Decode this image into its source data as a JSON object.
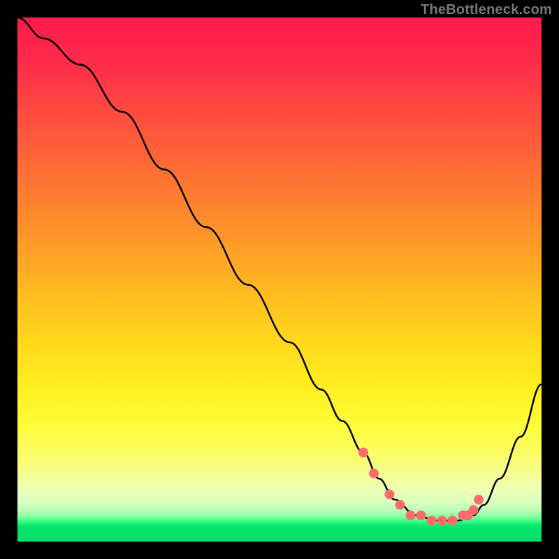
{
  "watermark": "TheBottleneck.com",
  "chart_data": {
    "type": "line",
    "title": "",
    "xlabel": "",
    "ylabel": "",
    "xlim": [
      0,
      100
    ],
    "ylim": [
      0,
      100
    ],
    "grid": false,
    "series": [
      {
        "name": "curve",
        "color": "#000000",
        "x": [
          0,
          5,
          12,
          20,
          28,
          36,
          44,
          52,
          58,
          62,
          66,
          69,
          72,
          76,
          80,
          84,
          87,
          89,
          92,
          96,
          100
        ],
        "y": [
          100,
          96,
          91,
          82,
          71,
          60,
          49,
          38,
          29,
          23,
          17,
          12,
          8,
          5,
          4,
          4,
          5,
          7,
          12,
          20,
          30
        ]
      }
    ],
    "markers": [
      {
        "name": "dots",
        "color": "#ff6b6b",
        "x": [
          66,
          68,
          71,
          73,
          75,
          77,
          79,
          81,
          83,
          85,
          86,
          87,
          88
        ],
        "y": [
          17,
          13,
          9,
          7,
          5,
          5,
          4,
          4,
          4,
          5,
          5,
          6,
          8
        ]
      }
    ],
    "gradient_stops": [
      {
        "pos": 0.0,
        "color": "#ff1a4d"
      },
      {
        "pos": 0.3,
        "color": "#ff7a30"
      },
      {
        "pos": 0.6,
        "color": "#ffd81c"
      },
      {
        "pos": 0.82,
        "color": "#fbfd64"
      },
      {
        "pos": 0.92,
        "color": "#d9ffc0"
      },
      {
        "pos": 0.96,
        "color": "#2fff84"
      },
      {
        "pos": 1.0,
        "color": "#07e06a"
      }
    ]
  }
}
